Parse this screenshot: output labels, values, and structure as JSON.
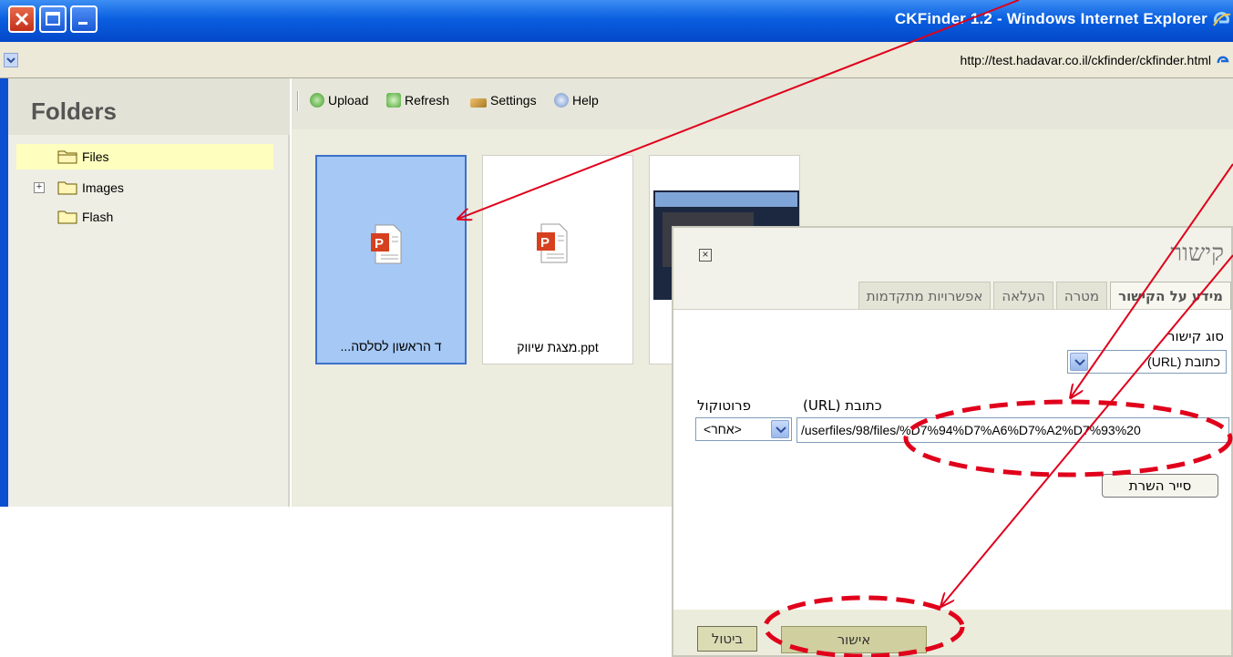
{
  "window": {
    "title": "CKFinder 1.2 - Windows Internet Explorer",
    "address": "http://test.hadavar.co.il/ckfinder/ckfinder.html"
  },
  "sidebar": {
    "title": "Folders",
    "folders": [
      {
        "label": "Files",
        "selected": true,
        "expandable": false,
        "icon": "folder-icon"
      },
      {
        "label": "Images",
        "selected": false,
        "expandable": true,
        "icon": "folder-icon"
      },
      {
        "label": "Flash",
        "selected": false,
        "expandable": false,
        "icon": "folder-icon"
      }
    ]
  },
  "toolbar": {
    "upload": "Upload",
    "refresh": "Refresh",
    "settings": "Settings",
    "help": "Help"
  },
  "files": [
    {
      "name": "...ד הראשון לסלסה",
      "type": "ppt",
      "selected": true
    },
    {
      "name": "מצגת שיווק.ppt",
      "type": "ppt",
      "selected": false
    },
    {
      "name": "",
      "type": "image",
      "selected": false
    }
  ],
  "dialog": {
    "title": "קישור",
    "tabs": [
      "מידע על הקישור",
      "מטרה",
      "העלאה",
      "אפשרויות מתקדמות"
    ],
    "link_type_label": "סוג קישור",
    "link_type_value": "כתובת (URL)",
    "protocol_label": "פרוטוקול",
    "protocol_value": "<אחר>",
    "url_label": "כתובת (URL)",
    "url_value": "/userfiles/98/files/%D7%94%D7%A6%D7%A2%D7%93%20",
    "browse_button": "סייר השרת",
    "ok_button": "אישור",
    "cancel_button": "ביטול"
  },
  "annotation_colors": {
    "arrow": "#e0001b",
    "highlight_ellipse": "#e0001b"
  }
}
